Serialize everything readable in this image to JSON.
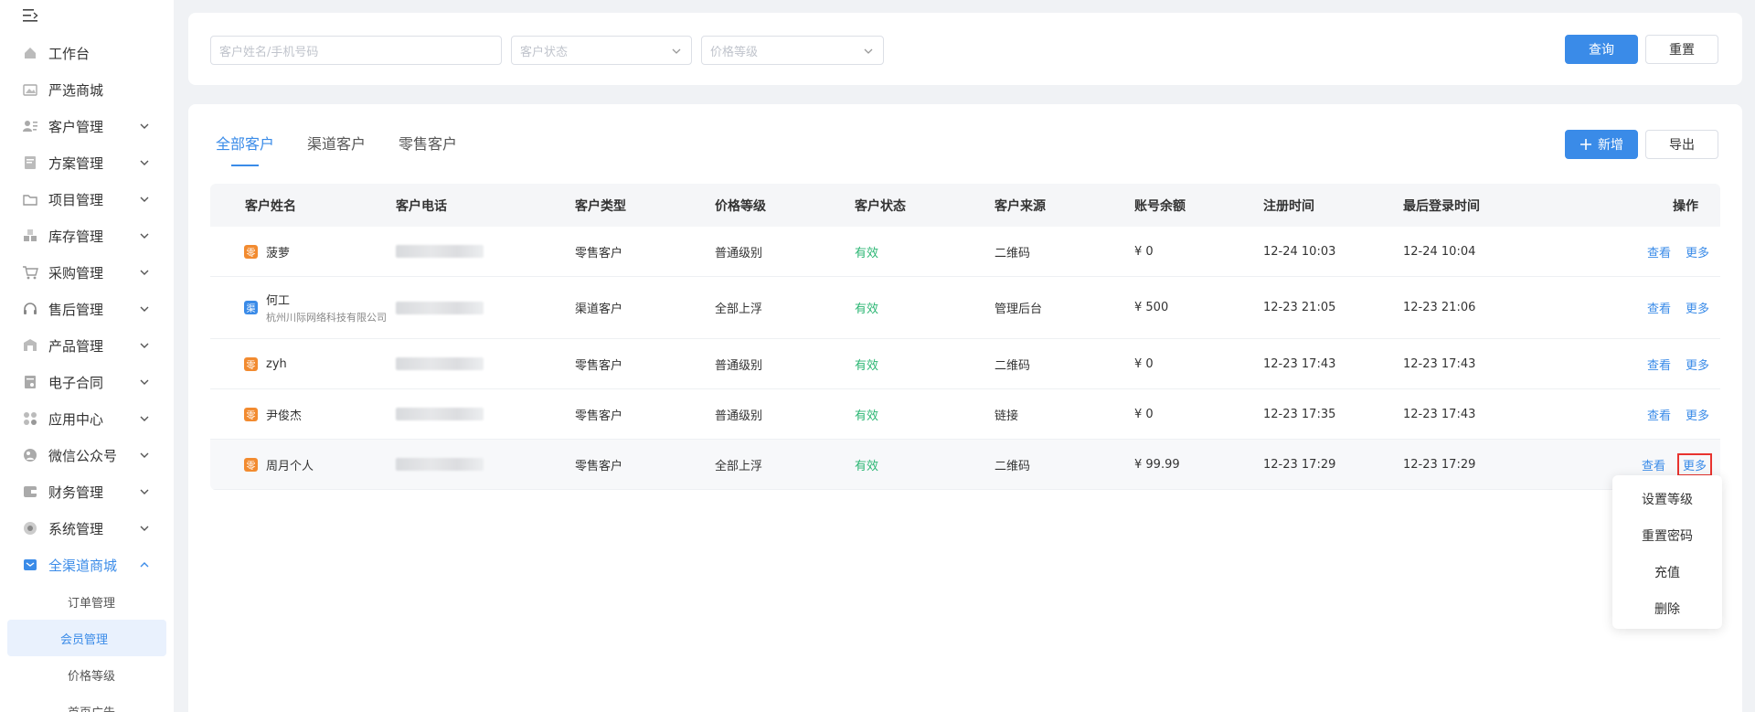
{
  "sidebar": {
    "items": [
      {
        "label": "工作台",
        "icon": "home-icon",
        "has_children": false
      },
      {
        "label": "严选商城",
        "icon": "image-icon",
        "has_children": false
      },
      {
        "label": "客户管理",
        "icon": "customer-list-icon",
        "has_children": true
      },
      {
        "label": "方案管理",
        "icon": "plan-icon",
        "has_children": true
      },
      {
        "label": "项目管理",
        "icon": "folder-icon",
        "has_children": true
      },
      {
        "label": "库存管理",
        "icon": "inventory-icon",
        "has_children": true
      },
      {
        "label": "采购管理",
        "icon": "cart-icon",
        "has_children": true
      },
      {
        "label": "售后管理",
        "icon": "headset-icon",
        "has_children": true
      },
      {
        "label": "产品管理",
        "icon": "product-icon",
        "has_children": true
      },
      {
        "label": "电子合同",
        "icon": "contract-icon",
        "has_children": true
      },
      {
        "label": "应用中心",
        "icon": "apps-icon",
        "has_children": true
      },
      {
        "label": "微信公众号",
        "icon": "wechat-icon",
        "has_children": true
      },
      {
        "label": "财务管理",
        "icon": "finance-icon",
        "has_children": true
      },
      {
        "label": "系统管理",
        "icon": "settings-icon",
        "has_children": true
      },
      {
        "label": "全渠道商城",
        "icon": "mall-icon",
        "has_children": true,
        "expanded": true
      }
    ],
    "subitems": [
      {
        "label": "订单管理",
        "active": false
      },
      {
        "label": "会员管理",
        "active": true
      },
      {
        "label": "价格等级",
        "active": false
      },
      {
        "label": "首页广告",
        "active": false
      }
    ]
  },
  "search": {
    "name_placeholder": "客户姓名/手机号码",
    "status_placeholder": "客户状态",
    "level_placeholder": "价格等级",
    "query_label": "查询",
    "reset_label": "重置"
  },
  "tabs": [
    "全部客户",
    "渠道客户",
    "零售客户"
  ],
  "actions": {
    "add_label": "新增",
    "export_label": "导出"
  },
  "table": {
    "headers": [
      "客户姓名",
      "客户电话",
      "客户类型",
      "价格等级",
      "客户状态",
      "客户来源",
      "账号余额",
      "注册时间",
      "最后登录时间",
      "操作"
    ],
    "rows": [
      {
        "badge": "零",
        "badge_color": "#f28b30",
        "name": "菠萝",
        "company": "",
        "type": "零售客户",
        "level": "普通级别",
        "status": "有效",
        "source": "二维码",
        "balance": "¥ 0",
        "reg": "12-24 10:03",
        "last": "12-24 10:04"
      },
      {
        "badge": "渠",
        "badge_color": "#3a8be8",
        "name": "何工",
        "company": "杭州川际网络科技有限公司",
        "type": "渠道客户",
        "level": "全部上浮",
        "status": "有效",
        "source": "管理后台",
        "balance": "¥ 500",
        "reg": "12-23 21:05",
        "last": "12-23 21:06"
      },
      {
        "badge": "零",
        "badge_color": "#f28b30",
        "name": "zyh",
        "company": "",
        "type": "零售客户",
        "level": "普通级别",
        "status": "有效",
        "source": "二维码",
        "balance": "¥ 0",
        "reg": "12-23 17:43",
        "last": "12-23 17:43"
      },
      {
        "badge": "零",
        "badge_color": "#f28b30",
        "name": "尹俊杰",
        "company": "",
        "type": "零售客户",
        "level": "普通级别",
        "status": "有效",
        "source": "链接",
        "balance": "¥ 0",
        "reg": "12-23 17:35",
        "last": "12-23 17:43"
      },
      {
        "badge": "零",
        "badge_color": "#f28b30",
        "name": "周月个人",
        "company": "",
        "type": "零售客户",
        "level": "全部上浮",
        "status": "有效",
        "source": "二维码",
        "balance": "¥ 99.99",
        "reg": "12-23 17:29",
        "last": "12-23 17:29"
      }
    ],
    "view_label": "查看",
    "more_label": "更多"
  },
  "dropdown": [
    "设置等级",
    "重置密码",
    "充值",
    "删除"
  ],
  "colors": {
    "primary": "#3a8be8",
    "success": "#2bb673",
    "retail_badge": "#f28b30",
    "highlight": "#e8332f"
  }
}
